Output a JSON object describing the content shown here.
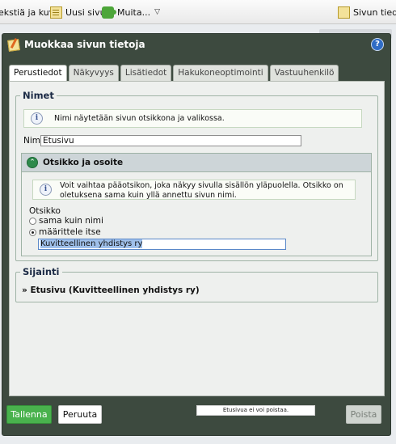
{
  "toolbar": {
    "items": [
      {
        "label": "ekstiä ja kuvia"
      },
      {
        "label": "Uusi sivu",
        "icon": "new-page-icon"
      },
      {
        "label": "Muita...",
        "icon": "puzzle-icon"
      },
      {
        "label": "Sivun tiedot",
        "icon": "page-info-icon"
      }
    ]
  },
  "dialog": {
    "title": "Muokkaa sivun tietoja",
    "help_label": "?"
  },
  "tabs": [
    {
      "label": "Perustiedot",
      "active": true
    },
    {
      "label": "Näkyvyys"
    },
    {
      "label": "Lisätiedot"
    },
    {
      "label": "Hakukoneoptimointi"
    },
    {
      "label": "Vastuuhenkilö"
    }
  ],
  "names_section": {
    "legend": "Nimet",
    "info_text": "Nimi näytetään sivun otsikkona ja valikossa.",
    "name_label": "Nimi",
    "name_value": "Etusivu"
  },
  "title_section": {
    "header": "Otsikko ja osoite",
    "info_text": "Voit vaihtaa pääotsikon, joka näkyy sivulla sisällön yläpuolella. Otsikko on oletuksena sama kuin yllä annettu sivun nimi.",
    "title_label": "Otsikko",
    "option_same": "sama kuin nimi",
    "option_custom": "määrittele itse",
    "selected_option": "määrittele itse",
    "title_value": "Kuvitteellinen yhdistys ry"
  },
  "location_section": {
    "legend": "Sijainti",
    "path": "» Etusivu (Kuvitteellinen yhdistys ry)"
  },
  "footer": {
    "save_label": "Tallenna",
    "cancel_label": "Peruuta",
    "status_note": "Etusivua ei voi poistaa.",
    "delete_label": "Poista"
  },
  "colors": {
    "dialog_header": "#3d4a3f",
    "save_button": "#49b24d",
    "panel_background": "#eef0ee",
    "collapse_header": "#cdd5d8"
  }
}
